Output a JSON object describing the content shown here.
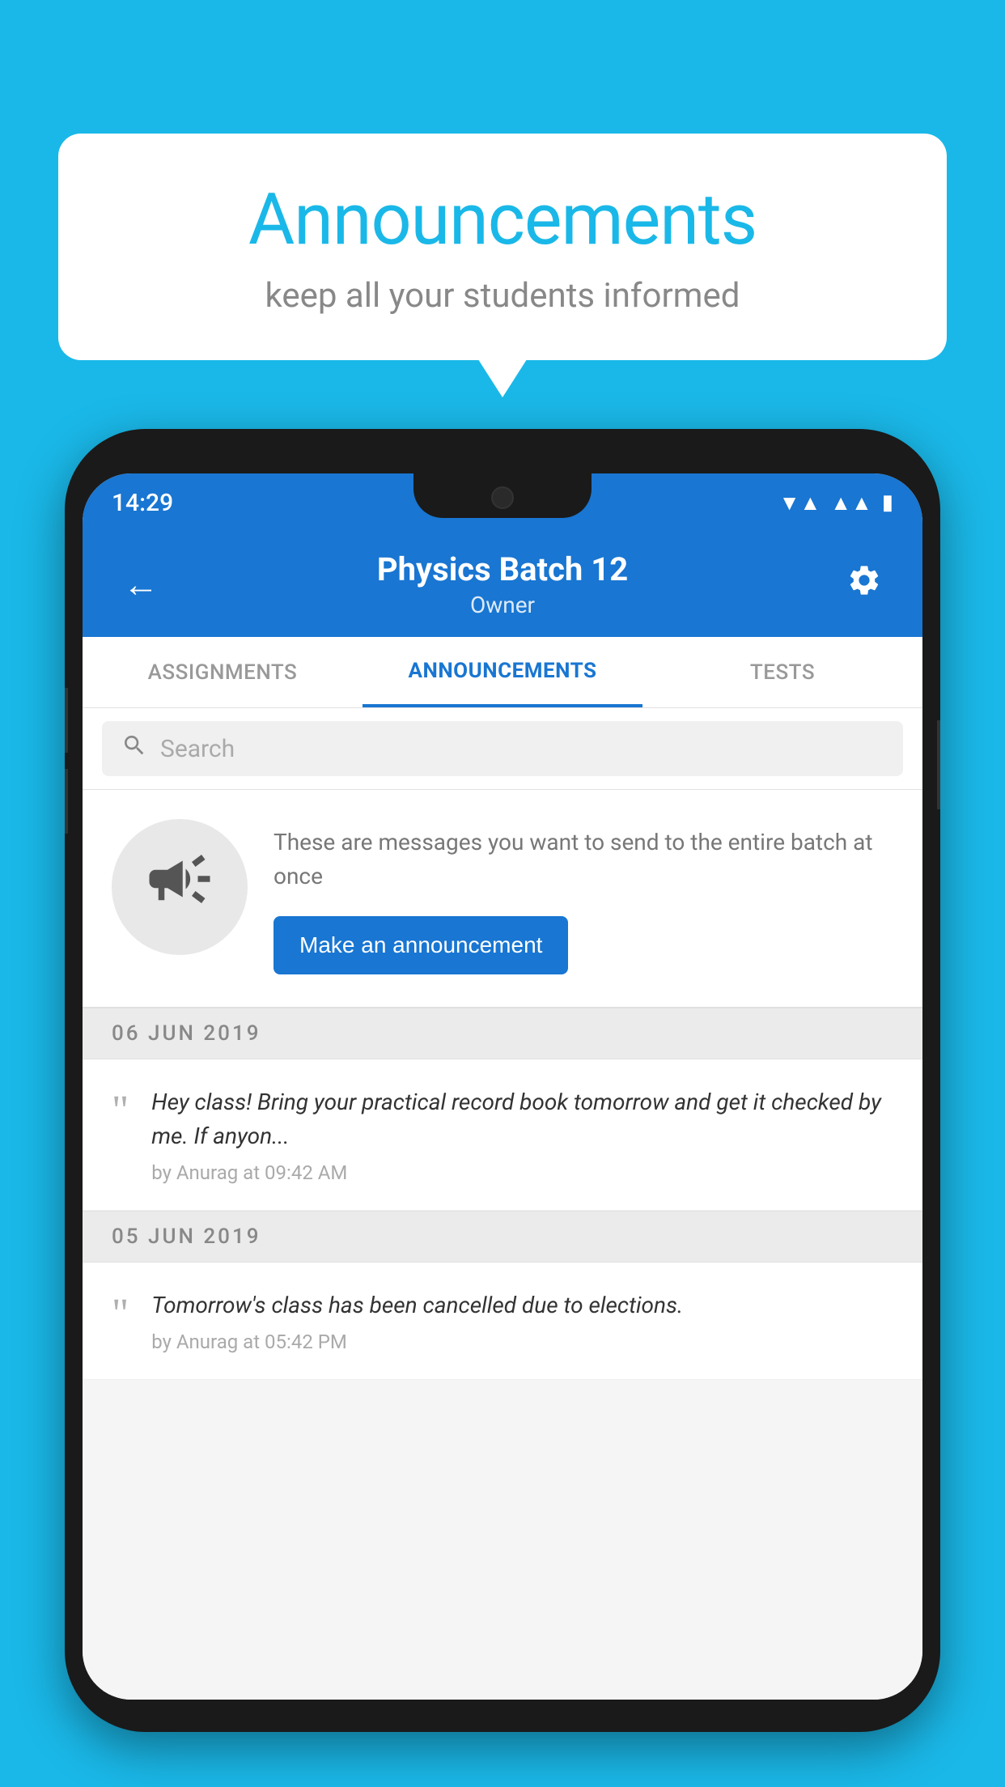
{
  "background_color": "#1ab8e8",
  "speech_bubble": {
    "title": "Announcements",
    "subtitle": "keep all your students informed"
  },
  "phone": {
    "status_bar": {
      "time": "14:29",
      "icons": [
        "wifi",
        "signal",
        "battery"
      ]
    },
    "header": {
      "title": "Physics Batch 12",
      "subtitle": "Owner",
      "back_label": "←",
      "settings_label": "⚙"
    },
    "tabs": [
      {
        "label": "ASSIGNMENTS",
        "active": false
      },
      {
        "label": "ANNOUNCEMENTS",
        "active": true
      },
      {
        "label": "TESTS",
        "active": false
      }
    ],
    "search": {
      "placeholder": "Search"
    },
    "promo": {
      "description": "These are messages you want to send to the entire batch at once",
      "button_label": "Make an announcement"
    },
    "announcements": [
      {
        "date": "06  JUN  2019",
        "text": "Hey class! Bring your practical record book tomorrow and get it checked by me. If anyon...",
        "meta": "by Anurag at 09:42 AM"
      },
      {
        "date": "05  JUN  2019",
        "text": "Tomorrow's class has been cancelled due to elections.",
        "meta": "by Anurag at 05:42 PM"
      }
    ]
  }
}
